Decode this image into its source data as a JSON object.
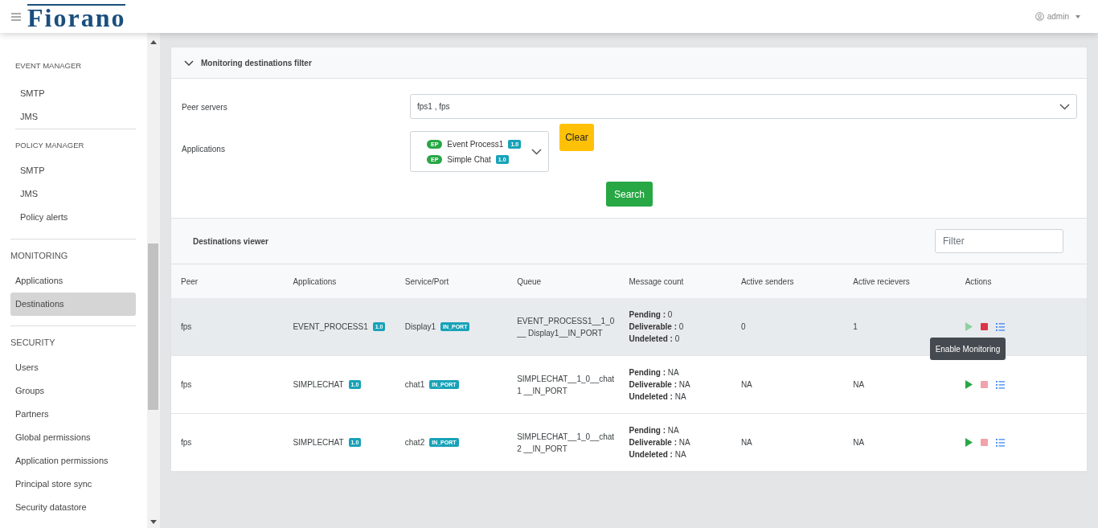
{
  "header": {
    "logo": "Fiorano",
    "user": "admin"
  },
  "sidebar": {
    "groups": [
      {
        "title": "EVENT MANAGER",
        "kind": "subsection",
        "items": [
          {
            "label": "SMTP",
            "selected": false
          },
          {
            "label": "JMS",
            "selected": false
          }
        ]
      },
      {
        "title": "POLICY MANAGER",
        "kind": "subsection",
        "items": [
          {
            "label": "SMTP",
            "selected": false
          },
          {
            "label": "JMS",
            "selected": false
          },
          {
            "label": "Policy alerts",
            "selected": false
          }
        ]
      },
      {
        "title": "MONITORING",
        "kind": "section",
        "items": [
          {
            "label": "Applications",
            "selected": false
          },
          {
            "label": "Destinations",
            "selected": true
          }
        ]
      },
      {
        "title": "SECURITY",
        "kind": "section",
        "items": [
          {
            "label": "Users",
            "selected": false
          },
          {
            "label": "Groups",
            "selected": false
          },
          {
            "label": "Partners",
            "selected": false
          },
          {
            "label": "Global permissions",
            "selected": false
          },
          {
            "label": "Application permissions",
            "selected": false
          },
          {
            "label": "Principal store sync",
            "selected": false
          },
          {
            "label": "Security datastore",
            "selected": false
          }
        ]
      }
    ]
  },
  "filter": {
    "title": "Monitoring destinations filter",
    "expanded": true,
    "peer_servers": {
      "label": "Peer servers",
      "value": "fps1 , fps"
    },
    "applications": {
      "label": "Applications",
      "items": [
        {
          "badge": "EP",
          "name": "Event Process1",
          "version": "1.0"
        },
        {
          "badge": "EP",
          "name": "Simple Chat",
          "version": "1.0"
        }
      ]
    },
    "clear_button": "Clear",
    "search_button": "Search"
  },
  "viewer": {
    "title": "Destinations viewer",
    "filter_placeholder": "Filter",
    "columns": [
      "Peer",
      "Applications",
      "Service/Port",
      "Queue",
      "Message count",
      "Active senders",
      "Active recievers",
      "Actions"
    ],
    "rows": [
      {
        "selected": true,
        "peer": "fps",
        "application": "EVENT_PROCESS1",
        "app_version": "1.0",
        "service": "Display1",
        "port_type": "IN_PORT",
        "queue": "EVENT_PROCESS1__1_0__ Display1__IN_PORT",
        "counts": [
          {
            "label": "Pending :",
            "value": "0"
          },
          {
            "label": "Deliverable :",
            "value": "0"
          },
          {
            "label": "Undeleted :",
            "value": "0"
          }
        ],
        "senders": "0",
        "receivers": "1",
        "monitoring": true,
        "tooltip": "Enable Monitoring"
      },
      {
        "selected": false,
        "peer": "fps",
        "application": "SIMPLECHAT",
        "app_version": "1.0",
        "service": "chat1",
        "port_type": "IN_PORT",
        "queue": "SIMPLECHAT__1_0__chat1 __IN_PORT",
        "counts": [
          {
            "label": "Pending :",
            "value": "NA"
          },
          {
            "label": "Deliverable :",
            "value": "NA"
          },
          {
            "label": "Undeleted :",
            "value": "NA"
          }
        ],
        "senders": "NA",
        "receivers": "NA",
        "monitoring": false
      },
      {
        "selected": false,
        "peer": "fps",
        "application": "SIMPLECHAT",
        "app_version": "1.0",
        "service": "chat2",
        "port_type": "IN_PORT",
        "queue": "SIMPLECHAT__1_0__chat2 __IN_PORT",
        "counts": [
          {
            "label": "Pending :",
            "value": "NA"
          },
          {
            "label": "Deliverable :",
            "value": "NA"
          },
          {
            "label": "Undeleted :",
            "value": "NA"
          }
        ],
        "senders": "NA",
        "receivers": "NA",
        "monitoring": false
      }
    ]
  }
}
